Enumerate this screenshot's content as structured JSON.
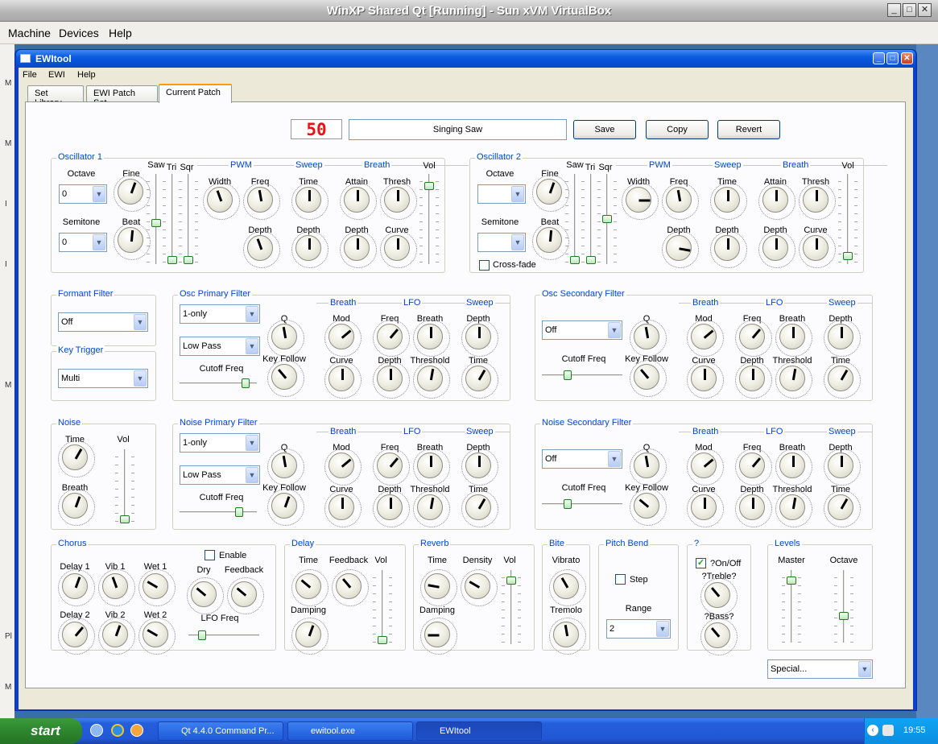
{
  "vbox": {
    "title": "WinXP Shared Qt [Running] - Sun xVM VirtualBox",
    "menu": [
      "Machine",
      "Devices",
      "Help"
    ]
  },
  "app": {
    "title": "EWItool",
    "menu": [
      "File",
      "EWI",
      "Help"
    ],
    "tabs": [
      "Set Library",
      "EWI Patch Set",
      "Current Patch"
    ]
  },
  "patch": {
    "number": "50",
    "name": "Singing Saw",
    "buttons": [
      "Save",
      "Copy",
      "Revert"
    ]
  },
  "osc1": {
    "title": "Oscillator 1",
    "octave": "Octave",
    "octave_val": "0",
    "semitone": "Semitone",
    "semitone_val": "0",
    "fine": "Fine",
    "beat": "Beat",
    "saw": "Saw",
    "tri": "Tri",
    "sqr": "Sqr",
    "pwm": "PWM",
    "width": "Width",
    "freq": "Freq",
    "sweep": "Sweep",
    "time": "Time",
    "depth": "Depth",
    "breath": "Breath",
    "attain": "Attain",
    "thresh": "Thresh",
    "curve": "Curve",
    "vol": "Vol"
  },
  "osc2": {
    "title": "Oscillator 2",
    "crossfade": "Cross-fade"
  },
  "formant": {
    "title": "Formant Filter",
    "value": "Off"
  },
  "keytrig": {
    "title": "Key Trigger",
    "value": "Multi"
  },
  "filter": {
    "mode": "1-only",
    "type": "Low Pass",
    "off": "Off",
    "cutoff": "Cutoff Freq",
    "q": "Q",
    "keyfollow": "Key Follow",
    "breath": "Breath",
    "lfo": "LFO",
    "sweep": "Sweep",
    "mod": "Mod",
    "curve": "Curve",
    "freq": "Freq",
    "depth": "Depth",
    "threshold": "Threshold",
    "time": "Time"
  },
  "groups": {
    "opf": "Osc Primary Filter",
    "osf": "Osc Secondary Filter",
    "noise": "Noise",
    "npf": "Noise Primary Filter",
    "nsf": "Noise Secondary Filter"
  },
  "noise": {
    "time": "Time",
    "breath": "Breath",
    "vol": "Vol"
  },
  "chorus": {
    "title": "Chorus",
    "enable": "Enable",
    "delay1": "Delay 1",
    "vib1": "Vib 1",
    "wet1": "Wet 1",
    "delay2": "Delay 2",
    "vib2": "Vib 2",
    "wet2": "Wet 2",
    "dry": "Dry",
    "feedback": "Feedback",
    "lfofreq": "LFO Freq"
  },
  "delay": {
    "title": "Delay",
    "time": "Time",
    "feedback": "Feedback",
    "vol": "Vol",
    "damping": "Damping"
  },
  "reverb": {
    "title": "Reverb",
    "time": "Time",
    "density": "Density",
    "vol": "Vol",
    "damping": "Damping"
  },
  "bite": {
    "title": "Bite",
    "vibrato": "Vibrato",
    "tremolo": "Tremolo"
  },
  "pitchbend": {
    "title": "Pitch Bend",
    "step": "Step",
    "range": "Range",
    "range_val": "2"
  },
  "eq": {
    "title": "?",
    "onoff": "?On/Off",
    "treble": "?Treble?",
    "bass": "?Bass?"
  },
  "levels": {
    "title": "Levels",
    "master": "Master",
    "octave": "Octave"
  },
  "special": {
    "value": "Special..."
  },
  "taskbar": {
    "start": "start",
    "items": [
      "Qt 4.4.0 Command Pr...",
      "ewitool.exe",
      "EWItool"
    ],
    "clock": "19:55"
  },
  "left_strip": [
    "M",
    "M",
    "I",
    "I",
    "M",
    "Pl",
    "M"
  ]
}
